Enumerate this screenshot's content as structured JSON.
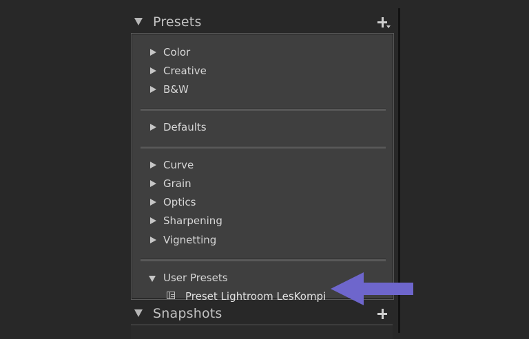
{
  "presets_panel": {
    "title": "Presets",
    "add_button": "add-icon",
    "groups": [
      [
        "Color",
        "Creative",
        "B&W"
      ],
      [
        "Defaults"
      ],
      [
        "Curve",
        "Grain",
        "Optics",
        "Sharpening",
        "Vignetting"
      ],
      [
        "User Presets"
      ]
    ],
    "user_presets": {
      "label": "User Presets",
      "expanded": true,
      "children": [
        "Preset Lightroom LesKompi"
      ]
    }
  },
  "snapshots_panel": {
    "title": "Snapshots",
    "add_button": "add-icon"
  },
  "annotation": {
    "arrow_color": "#6e66cc",
    "arrow_direction": "left"
  },
  "colors": {
    "background": "#282828",
    "panel": "#3f3f3f",
    "text": "#d6d6d6"
  }
}
